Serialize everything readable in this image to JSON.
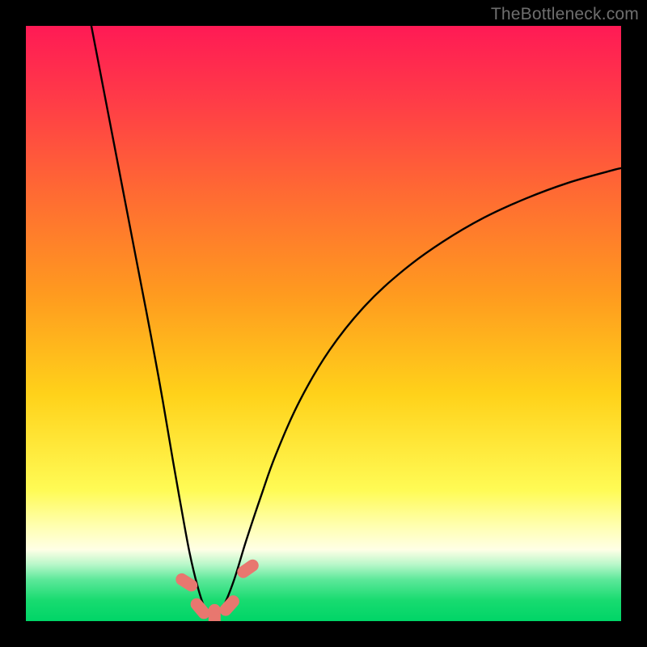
{
  "watermark": "TheBottleneck.com",
  "colors": {
    "frame": "#000000",
    "curve": "#000000",
    "marker_fill": "#e8776f",
    "marker_stroke": "#e8776f",
    "green_band_top": "#1bdc72",
    "green_band_bottom": "#00d567"
  },
  "chart_data": {
    "type": "line",
    "title": "",
    "xlabel": "",
    "ylabel": "",
    "xlim": [
      0,
      100
    ],
    "ylim": [
      0,
      100
    ],
    "background_gradient": {
      "stops": [
        {
          "pos": 0.0,
          "color": "#ff1a55"
        },
        {
          "pos": 0.12,
          "color": "#ff3a48"
        },
        {
          "pos": 0.28,
          "color": "#ff6a33"
        },
        {
          "pos": 0.45,
          "color": "#ff9a1f"
        },
        {
          "pos": 0.62,
          "color": "#ffd21a"
        },
        {
          "pos": 0.78,
          "color": "#fffb55"
        },
        {
          "pos": 0.84,
          "color": "#ffffb0"
        },
        {
          "pos": 0.88,
          "color": "#ffffe6"
        },
        {
          "pos": 0.905,
          "color": "#b8f7c9"
        },
        {
          "pos": 0.93,
          "color": "#5de89a"
        },
        {
          "pos": 0.965,
          "color": "#18db70"
        },
        {
          "pos": 1.0,
          "color": "#00d567"
        }
      ]
    },
    "series": [
      {
        "name": "bottleneck-curve",
        "x": [
          11.0,
          13.5,
          16.0,
          18.5,
          21.0,
          23.0,
          24.7,
          26.2,
          27.5,
          28.8,
          30.0,
          31.0,
          32.0,
          33.2,
          35.0,
          37.0,
          39.5,
          42.0,
          46.0,
          51.0,
          57.0,
          63.5,
          70.0,
          77.0,
          84.0,
          91.0,
          98.0,
          100.0
        ],
        "y": [
          100.0,
          87.0,
          74.0,
          61.0,
          48.0,
          37.0,
          27.0,
          18.5,
          11.5,
          6.0,
          2.3,
          0.9,
          0.9,
          2.5,
          7.0,
          13.5,
          21.0,
          28.0,
          37.0,
          45.5,
          53.0,
          59.0,
          63.7,
          67.8,
          71.0,
          73.6,
          75.6,
          76.1
        ]
      }
    ],
    "markers": [
      {
        "x": 27.0,
        "y": 6.5,
        "rot": -58
      },
      {
        "x": 29.3,
        "y": 2.1,
        "rot": -40
      },
      {
        "x": 31.7,
        "y": 0.9,
        "rot": 0
      },
      {
        "x": 34.2,
        "y": 2.6,
        "rot": 42
      },
      {
        "x": 37.3,
        "y": 8.8,
        "rot": 55
      }
    ]
  }
}
